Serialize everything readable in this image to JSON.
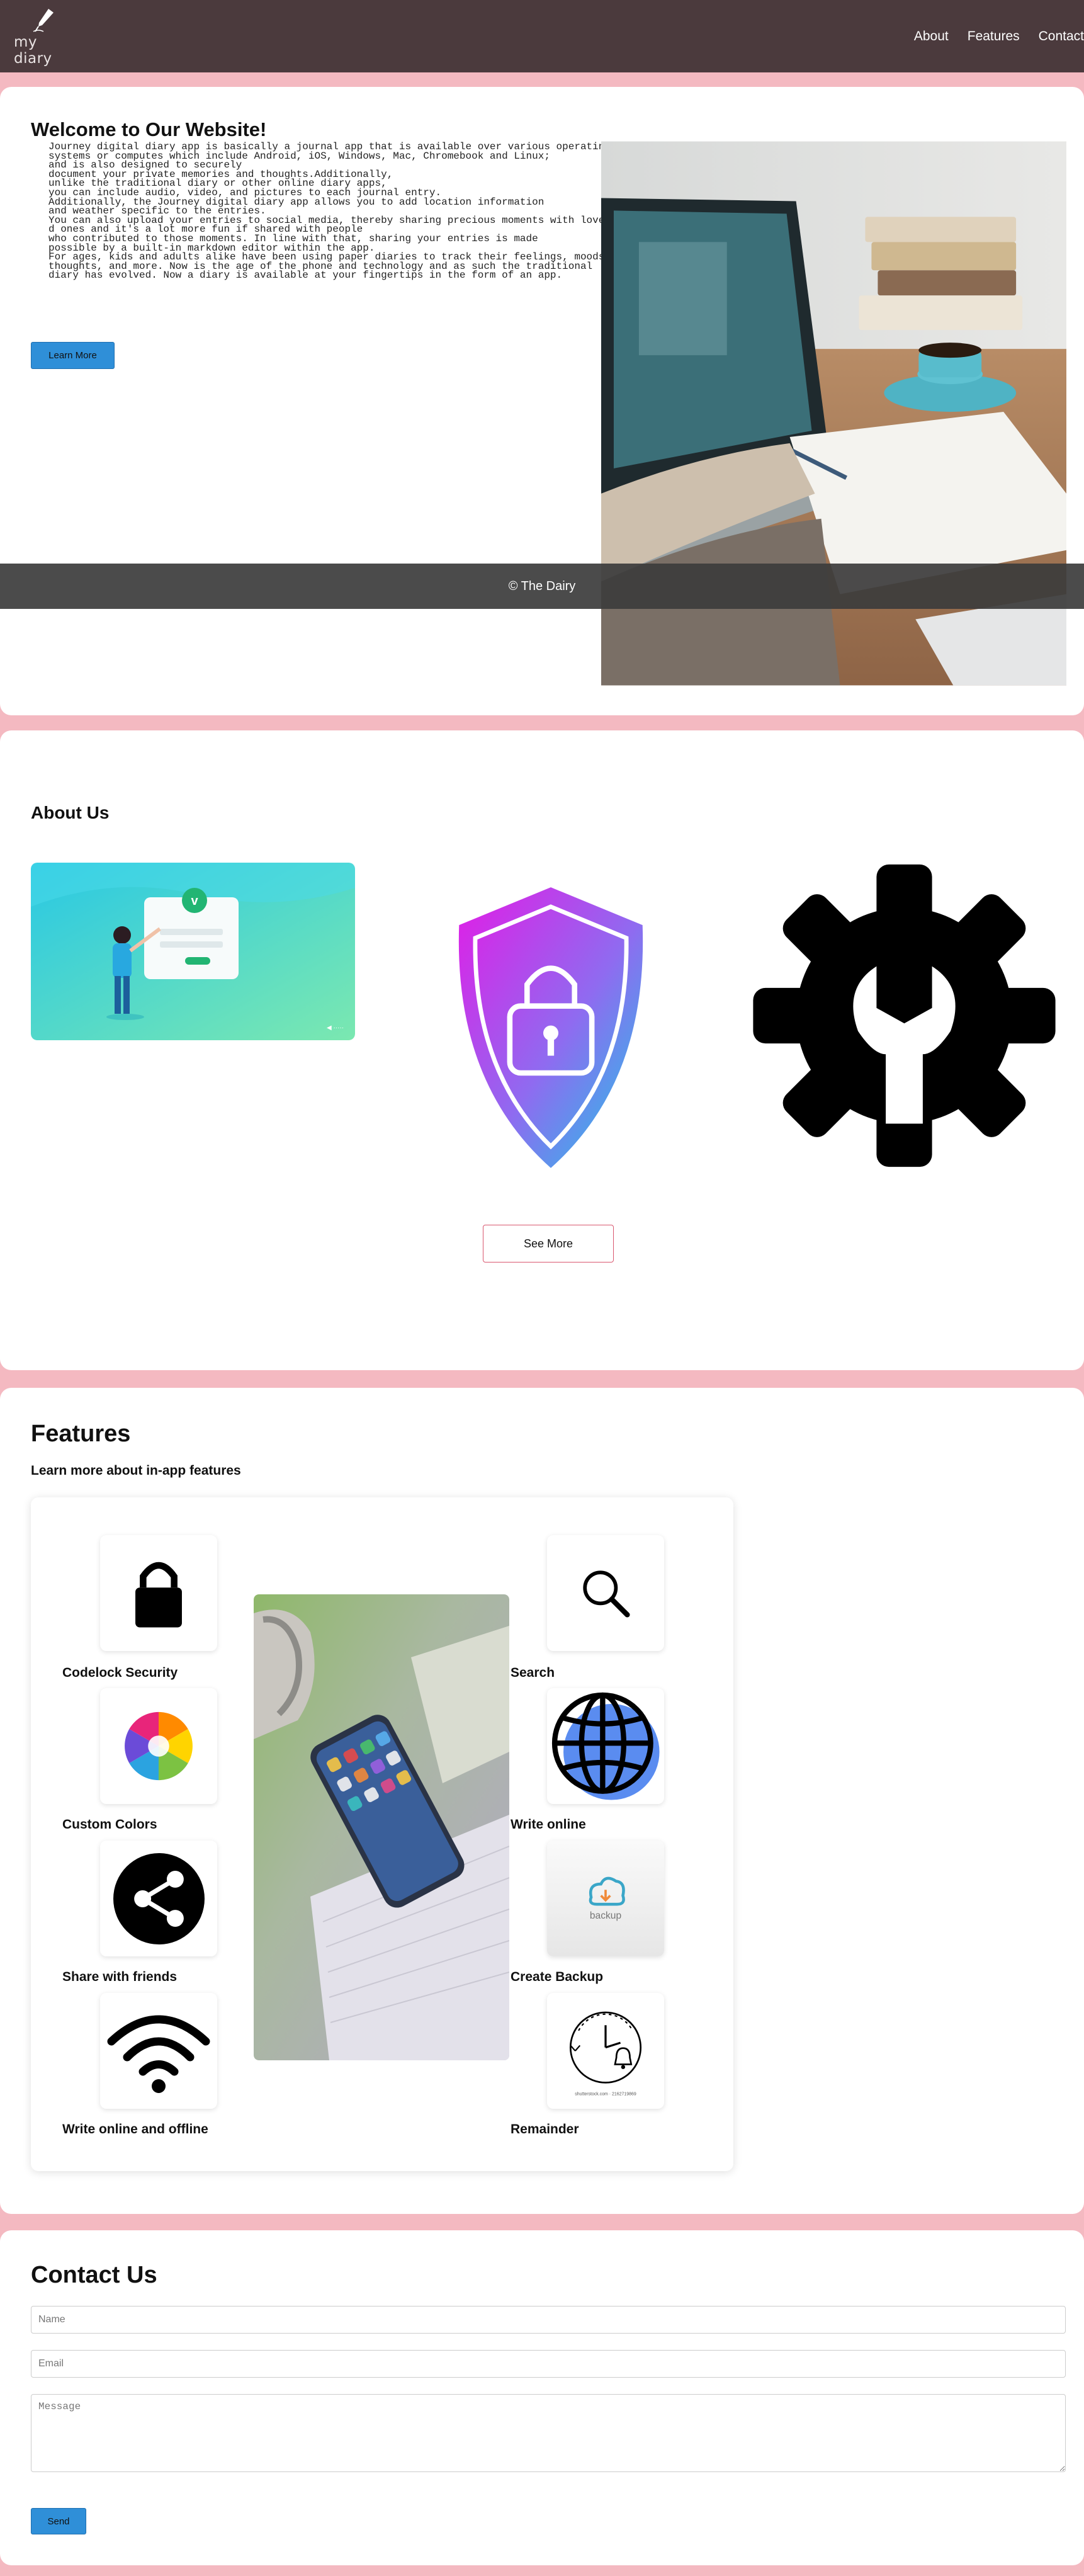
{
  "header": {
    "logo_text": "my diary",
    "nav": [
      {
        "label": "About"
      },
      {
        "label": "Features"
      },
      {
        "label": "Contact"
      }
    ]
  },
  "hero": {
    "title": "Welcome to Our Website!",
    "body_lines": [
      "Journey digital diary app is basically a journal app that is available over various operating",
      "systems or computes which include Android, iOS, Windows, Mac, Chromebook and Linux;",
      "and is also designed to securely",
      "document your private memories and thoughts.Additionally,",
      "unlike the traditional diary or other online diary apps,",
      "you can include audio, video, and pictures to each journal entry.",
      "Additionally, the Journey digital diary app allows you to add location information",
      "and weather specific to the entries.",
      "You can also upload your entries to social media, thereby sharing precious moments with love",
      "d ones and it's a lot more fun if shared with people",
      "who contributed to those moments. In line with that, sharing your entries is made",
      "possible by a built-in markdown editor within the app.",
      "For ages, kids and adults alike have been using paper diaries to track their feelings, moods,",
      "thoughts, and more. Now is the age of the phone and technology and as such the traditional",
      "diary has evolved. Now a diary is available at your fingertips in the form of an app."
    ],
    "button_label": "Learn More",
    "footer_text": "© The Dairy"
  },
  "about": {
    "title": "About Us",
    "image_logo_text": "v",
    "button_label": "See More"
  },
  "features": {
    "title": "Features",
    "subtitle": "Learn more about in-app features",
    "left": [
      {
        "label": "Codelock Security",
        "icon": "lock-icon"
      },
      {
        "label": "Custom Colors",
        "icon": "color-wheel-icon"
      },
      {
        "label": "Share with friends",
        "icon": "share-icon"
      },
      {
        "label": "Write online and offline",
        "icon": "wifi-icon"
      }
    ],
    "right": [
      {
        "label": "Search",
        "icon": "search-icon"
      },
      {
        "label": "Write online",
        "icon": "globe-icon"
      },
      {
        "label": "Create Backup",
        "icon": "cloud-backup-icon",
        "icon_text": "backup"
      },
      {
        "label": "Remainder",
        "icon": "alarm-clock-icon",
        "icon_text": "shutterstock.com · 2162719869"
      }
    ]
  },
  "contact": {
    "title": "Contact Us",
    "name_placeholder": "Name",
    "email_placeholder": "Email",
    "message_placeholder": "Message",
    "send_label": "Send"
  },
  "colors": {
    "header_bg": "#4b3a3d",
    "page_bg": "#f4b9c1",
    "accent_blue": "#2f8fd8",
    "outline_pink": "#d9576f"
  }
}
